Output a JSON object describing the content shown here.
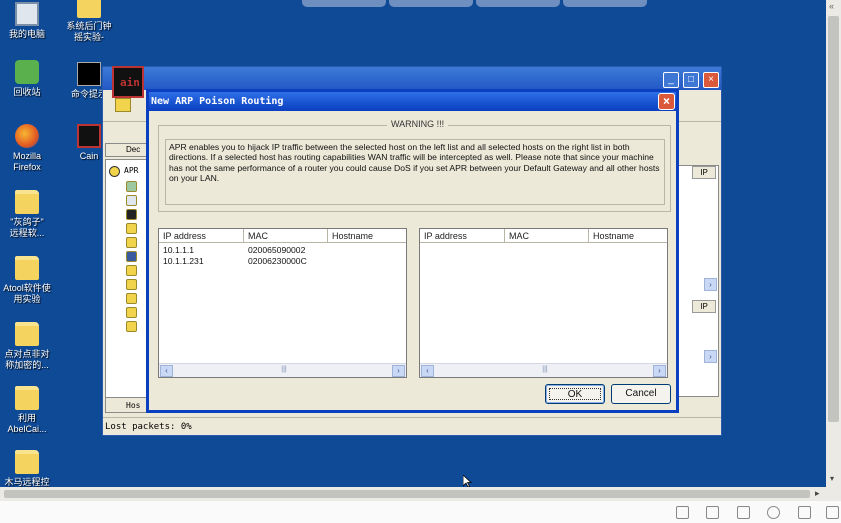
{
  "desktop": {
    "icons": [
      {
        "label": "我的电脑",
        "icon": "computer-icon"
      },
      {
        "label": "系统后门钟\n摇实验-",
        "icon": "folder-icon"
      },
      {
        "label": "回收站",
        "icon": "recycle-bin-icon"
      },
      {
        "label": "命令提示",
        "icon": "cmd-icon"
      },
      {
        "label": "Mozilla\nFirefox",
        "icon": "firefox-icon"
      },
      {
        "label": "Cain",
        "icon": "cain-icon"
      },
      {
        "label": "\"灰鸽子\"\n远程软...",
        "icon": "folder-icon"
      },
      {
        "label": "Atool软件使\n用实验",
        "icon": "folder-icon"
      },
      {
        "label": "点对点非对\n称加密的...",
        "icon": "folder-icon"
      },
      {
        "label": "利用\nAbelCai...",
        "icon": "folder-icon"
      },
      {
        "label": "木马远程控",
        "icon": "folder-icon"
      }
    ]
  },
  "cain_window": {
    "toolbar_tab": "Dec",
    "tree_root": "APR",
    "right_header": "IP",
    "bottom_tab": "Hos",
    "status_text": "Lost packets:    0%"
  },
  "dialog": {
    "title": "New ARP Poison Routing",
    "warning_legend": "WARNING !!!",
    "warning_text": "APR enables you to hijack IP traffic between the selected host on the left list and all selected hosts on the right list in both directions. If a selected host has routing capabilities WAN traffic will be intercepted as well. Please note that since your machine has not the same performance of a router you could cause DoS if you set APR between your Default Gateway and all other hosts on your LAN.",
    "left_list": {
      "columns": [
        "IP address",
        "MAC",
        "Hostname"
      ],
      "rows": [
        {
          "ip": "10.1.1.1",
          "mac": "020065090002",
          "hostname": ""
        },
        {
          "ip": "10.1.1.231",
          "mac": "02006230000C",
          "hostname": ""
        }
      ]
    },
    "right_list": {
      "columns": [
        "IP address",
        "MAC",
        "Hostname"
      ],
      "rows": []
    },
    "ok_label": "OK",
    "cancel_label": "Cancel"
  }
}
